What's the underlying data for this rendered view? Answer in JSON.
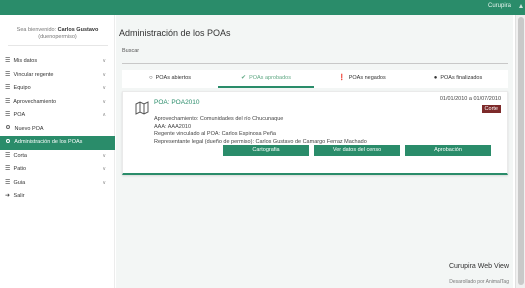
{
  "topbar": {
    "brand": "Curupira"
  },
  "sidebar": {
    "welcome_prefix": "Sea bienvenido:",
    "welcome_user": "Carlos Gustavo",
    "welcome_login": "(duenopermiso)",
    "items": [
      {
        "label": "Mis datos",
        "icon": "menu-icon"
      },
      {
        "label": "Vincular regente",
        "icon": "menu-icon"
      },
      {
        "label": "Equipo",
        "icon": "menu-icon"
      },
      {
        "label": "Aprovechamiento",
        "icon": "menu-icon"
      },
      {
        "label": "POA",
        "icon": "menu-icon"
      },
      {
        "label": "Nuevo POA",
        "icon": "circle-icon"
      },
      {
        "label": "Administración de los POAs",
        "icon": "circle-icon"
      },
      {
        "label": "Corta",
        "icon": "menu-icon"
      },
      {
        "label": "Patio",
        "icon": "menu-icon"
      },
      {
        "label": "Guia",
        "icon": "menu-icon"
      },
      {
        "label": "Salir",
        "icon": "logout-icon"
      }
    ]
  },
  "main": {
    "title": "Administración de los POAs",
    "search": {
      "label": "Buscar",
      "value": "",
      "placeholder": ""
    },
    "tabs": [
      {
        "label": "POAs abiertos",
        "icon": "circle-outline-icon"
      },
      {
        "label": "POAs aprobados",
        "icon": "check-circle-icon"
      },
      {
        "label": "POAs negados",
        "icon": "alert-circle-icon"
      },
      {
        "label": "POAs finalizados",
        "icon": "filled-circle-icon"
      }
    ],
    "card": {
      "title": "POA: POA2010",
      "dates": "01/01/2010 a 01/07/2010",
      "badge": "Corte",
      "lines": [
        "Aprovechamiento: Comunidades del río Chucunaque",
        "AAA: AAA2010",
        "Regente vinculado al POA: Carlos Espinosa Peña",
        "Representante legal (dueño de permiso): Carlos Gustavo de Camargo Ferraz Machado"
      ],
      "buttons": [
        "Cartografia",
        "Ver datos del censo",
        "Aprobación"
      ]
    },
    "footer": {
      "title": "Curupira Web View",
      "subtitle": "Desarollado por AnimalTag"
    }
  },
  "colors": {
    "primary": "#2a8c6a",
    "badge": "#7d2a2a",
    "tab_selected_text": "#5fa883"
  }
}
